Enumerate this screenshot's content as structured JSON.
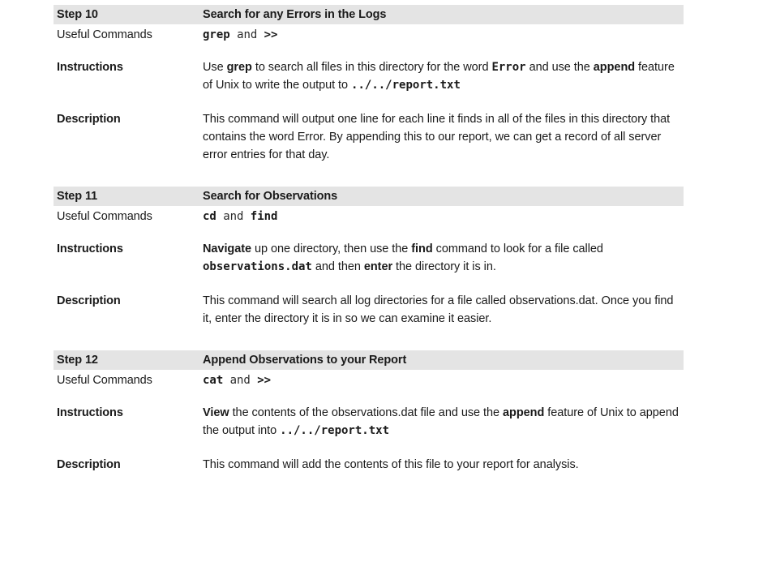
{
  "document": {
    "row_labels": {
      "useful_commands": "Useful Commands",
      "instructions": "Instructions",
      "description": "Description"
    },
    "conjunction": "and",
    "steps": [
      {
        "step_label": "Step 10",
        "title": "Search for any Errors in the Logs",
        "commands": [
          "grep",
          ">>"
        ],
        "instructions_runs": [
          {
            "text": "Use ",
            "style": "plain"
          },
          {
            "text": "grep",
            "style": "bold"
          },
          {
            "text": " to search all files in this directory for the word ",
            "style": "plain"
          },
          {
            "text": "Error",
            "style": "mono-bold"
          },
          {
            "text": " and use the ",
            "style": "plain"
          },
          {
            "text": "append",
            "style": "bold"
          },
          {
            "text": " feature of Unix to write the output to ",
            "style": "plain"
          },
          {
            "text": "../../report.txt",
            "style": "mono-bold"
          }
        ],
        "description": "This command will output one line for each line it finds in all of the files in this directory that contains the word Error.  By appending this to our report, we can get a record of all server error entries for that day."
      },
      {
        "step_label": "Step 11",
        "title": "Search for Observations",
        "commands": [
          "cd",
          "find"
        ],
        "instructions_runs": [
          {
            "text": "Navigate",
            "style": "bold"
          },
          {
            "text": " up one directory, then use the ",
            "style": "plain"
          },
          {
            "text": "find",
            "style": "bold"
          },
          {
            "text": " command to look for a file called ",
            "style": "plain"
          },
          {
            "text": "observations.dat",
            "style": "mono-bold"
          },
          {
            "text": " and then ",
            "style": "plain"
          },
          {
            "text": "enter",
            "style": "bold"
          },
          {
            "text": " the directory it is in.",
            "style": "plain"
          }
        ],
        "description": "This command will search all log directories for a file called observations.dat.  Once you find it, enter the directory it is in so we can examine it easier."
      },
      {
        "step_label": "Step 12",
        "title": "Append Observations to your Report",
        "commands": [
          "cat",
          ">>"
        ],
        "instructions_runs": [
          {
            "text": "View",
            "style": "bold"
          },
          {
            "text": " the contents of the observations.dat file and use the ",
            "style": "plain"
          },
          {
            "text": "append",
            "style": "bold"
          },
          {
            "text": " feature of Unix to append the output into ",
            "style": "plain"
          },
          {
            "text": "../../report.txt",
            "style": "mono-bold"
          }
        ],
        "description": "This command will add the contents of this file to your report for analysis."
      }
    ]
  }
}
